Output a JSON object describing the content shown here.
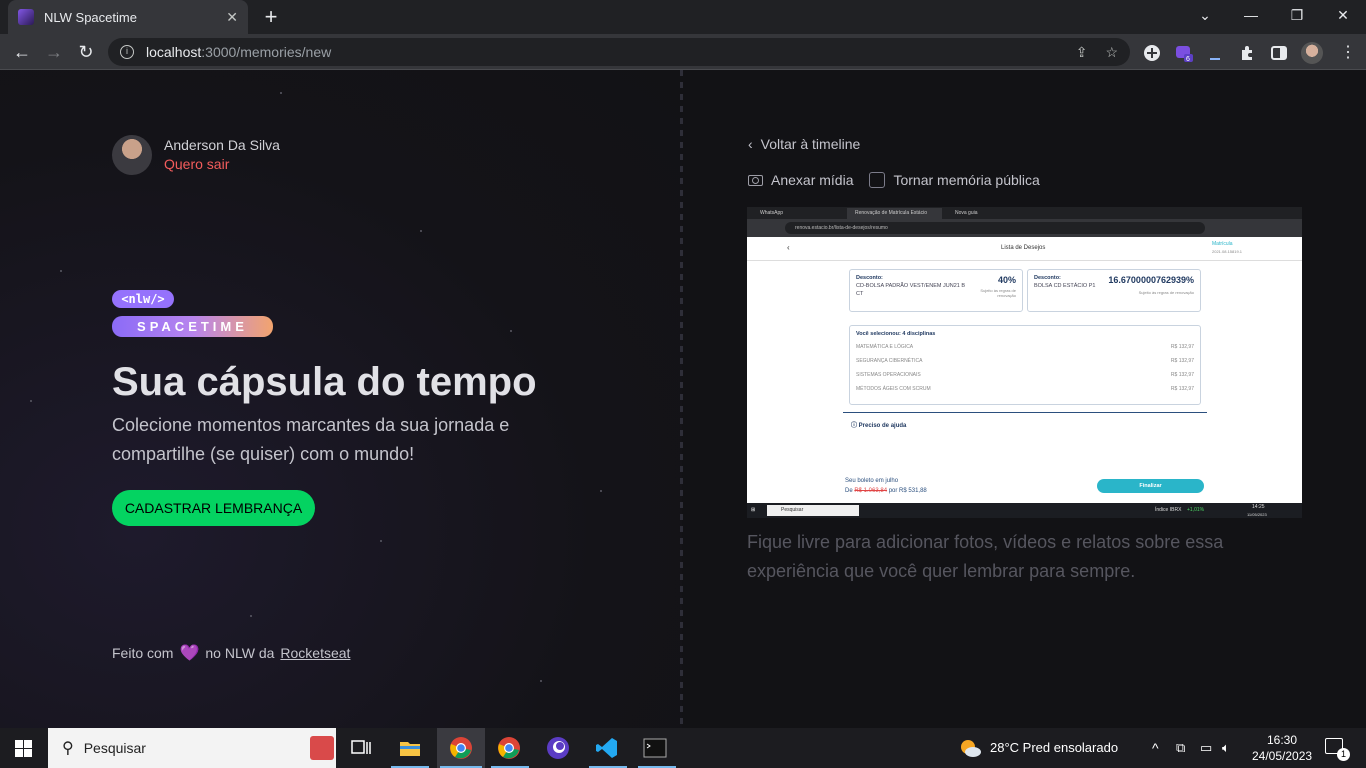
{
  "browser": {
    "tab_title": "NLW Spacetime",
    "tab_close": "✕",
    "new_tab": "+",
    "window_controls": [
      "⌄",
      "—",
      "❐",
      "✕"
    ],
    "url_host": "localhost",
    "url_rest": ":3000/memories/new"
  },
  "profile": {
    "name": "Anderson Da Silva",
    "logout": "Quero sair"
  },
  "logo": {
    "top": "<nlw/>",
    "bottom": "SPACETIME"
  },
  "hero": {
    "title": "Sua cápsula do tempo",
    "subtitle": "Colecione momentos marcantes da sua jornada e compartilhe (se quiser) com o mundo!",
    "cta": "CADASTRAR LEMBRANÇA"
  },
  "footer": {
    "prefix": "Feito com",
    "heart": "💜",
    "middle": "no NLW da",
    "link": "Rocketseat"
  },
  "form": {
    "back": "Voltar à timeline",
    "attach": "Anexar mídia",
    "public": "Tornar memória pública",
    "description": "Fique livre para adicionar fotos, vídeos e relatos sobre essa experiência que você quer lembrar para sempre."
  },
  "preview": {
    "tabs": [
      "WhatsApp",
      "Renovação de Matrícula Estácio",
      "Nova guia"
    ],
    "url": "renova.estacio.br/lista-de-desejos/resumo",
    "page_title": "Lista de Desejos",
    "matricula": "Matrícula",
    "matricula_no": "2021.08.15819.1",
    "discount1": {
      "label": "Desconto:",
      "value": "40%",
      "desc": "CD-BOLSA PADRÃO VEST/ENEM JUN21 B CT",
      "note": "Sujeito às regras de renovação"
    },
    "discount2": {
      "label": "Desconto:",
      "value": "16.6700000762939%",
      "desc": "BOLSA CD ESTÁCIO P1",
      "note": "Sujeito às regras de renovação"
    },
    "selected_label": "Você selecionou: 4 disciplinas",
    "disciplines": [
      {
        "name": "MATEMÁTICA E LÓGICA",
        "price": "R$ 132,97"
      },
      {
        "name": "SEGURANÇA CIBERNÉTICA",
        "price": "R$ 132,97"
      },
      {
        "name": "SISTEMAS OPERACIONAIS",
        "price": "R$ 132,97"
      },
      {
        "name": "MÉTODOS ÁGEIS COM SCRUM",
        "price": "R$ 132,97"
      }
    ],
    "help": "Preciso de ajuda",
    "boleto_line1": "Seu boleto em julho",
    "boleto_from": "De",
    "boleto_old": "R$ 1.063,84",
    "boleto_to": "por R$ 531,88",
    "finish": "Finalizar",
    "task_search": "Pesquisar",
    "task_index": "Índice IBRX",
    "task_index_val": "+1,01%",
    "task_time": "14:25",
    "task_date": "11/05/2023"
  },
  "taskbar": {
    "search": "Pesquisar",
    "weather": "28°C  Pred ensolarado",
    "time": "16:30",
    "date": "24/05/2023",
    "notifications": "1"
  }
}
